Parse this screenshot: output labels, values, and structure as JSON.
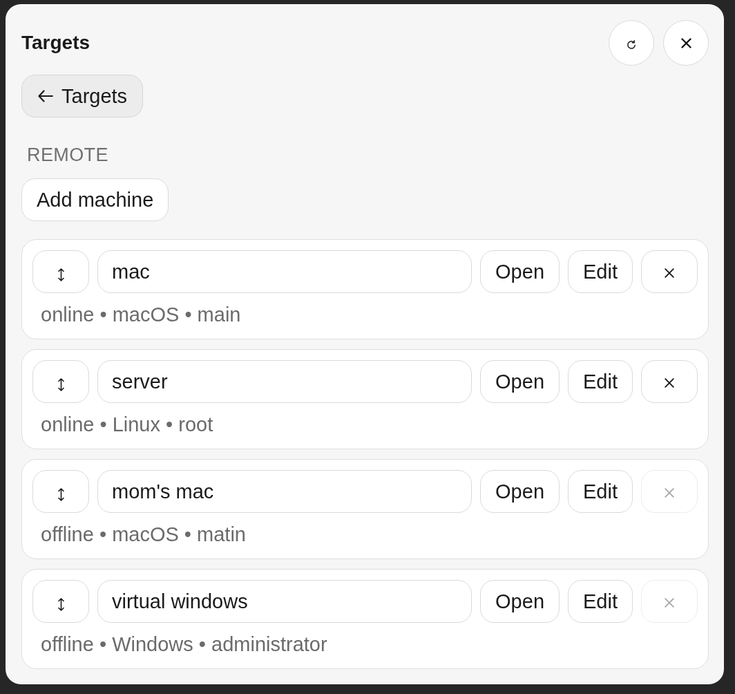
{
  "panel": {
    "title": "Targets"
  },
  "back_button": {
    "label": "Targets"
  },
  "section": {
    "label": "REMOTE"
  },
  "add_button": {
    "label": "Add machine"
  },
  "machines": [
    {
      "name": "mac",
      "actions": [
        {
          "label": "Open"
        },
        {
          "label": "Edit"
        }
      ],
      "delete": {
        "disabled": false
      },
      "details": "online • macOS • main"
    },
    {
      "name": "server",
      "actions": [
        {
          "label": "Open"
        },
        {
          "label": "Edit"
        }
      ],
      "delete": {
        "disabled": false
      },
      "details": "online • Linux • root"
    },
    {
      "name": "mom's mac",
      "actions": [
        {
          "label": "Open"
        },
        {
          "label": "Edit"
        }
      ],
      "delete": {
        "disabled": true
      },
      "details": "offline • macOS • matin"
    },
    {
      "name": "virtual windows",
      "actions": [
        {
          "label": "Open"
        },
        {
          "label": "Edit"
        }
      ],
      "delete": {
        "disabled": true
      },
      "details": "offline • Windows • administrator"
    }
  ]
}
